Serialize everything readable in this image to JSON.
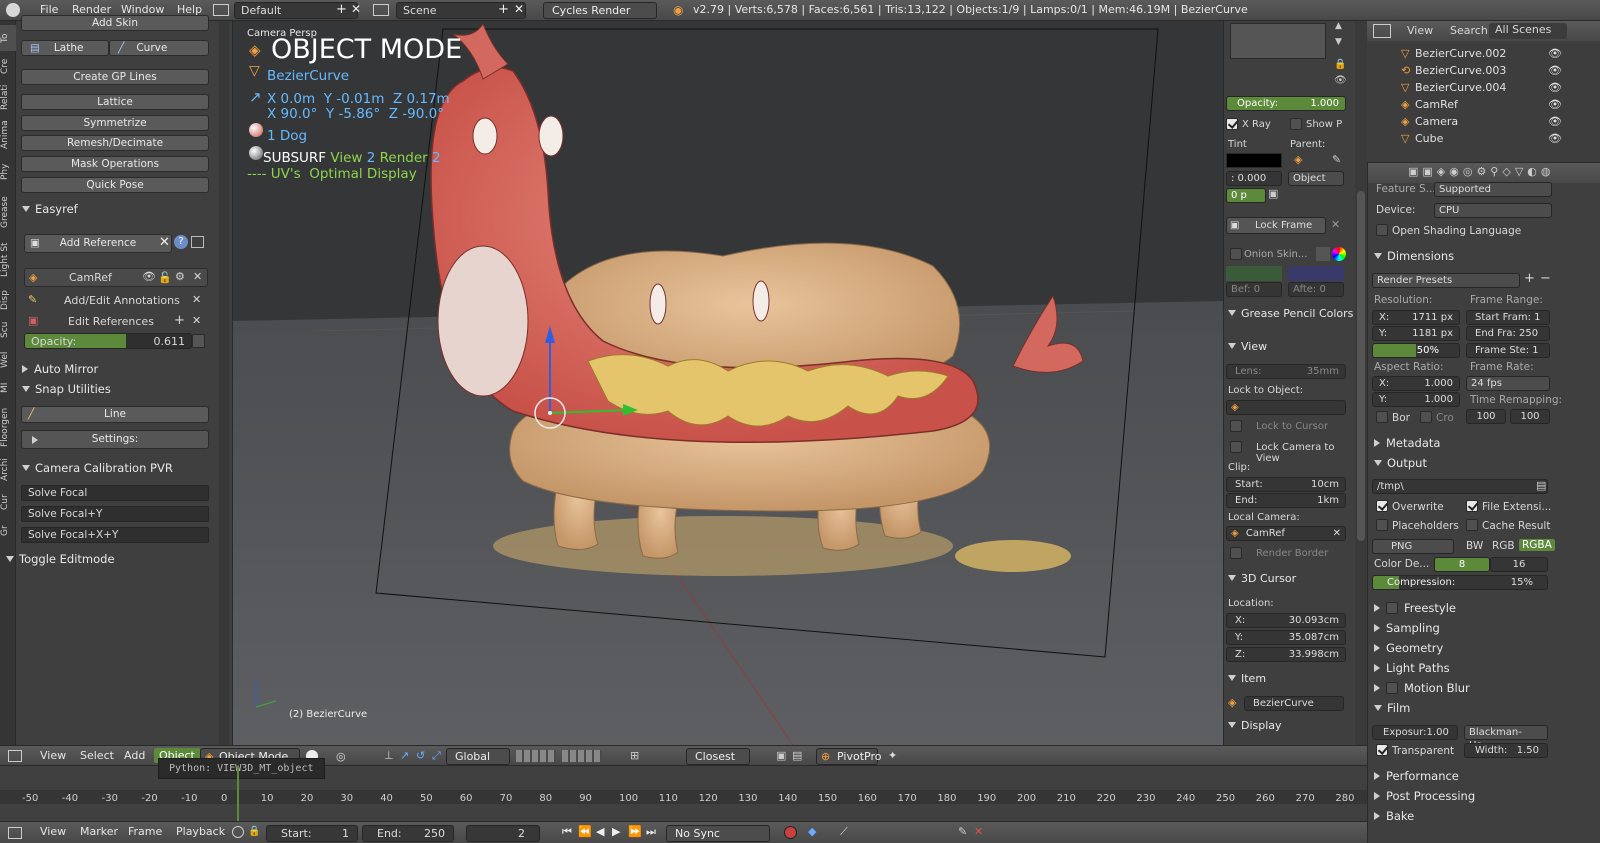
{
  "topbar": {
    "menu": [
      "File",
      "Render",
      "Window",
      "Help"
    ],
    "screen": "Default",
    "scene": "Scene",
    "engine": "Cycles Render",
    "stats": "v2.79 | Verts:6,578 | Faces:6,561 | Tris:13,122 | Objects:1/9 | Lamps:0/1 | Mem:46.19M | BezierCurve"
  },
  "vtabs": [
    "To",
    "Cre",
    "Relati",
    "Anima",
    "Phy",
    "Grease",
    "Light St",
    "Disp",
    "Scu",
    "Wel",
    "MI",
    "Floorgen",
    "Archi",
    "Cur",
    "Gr"
  ],
  "toolshelf": {
    "partial_top": "Add Skin",
    "lathe": "Lathe",
    "curve": "Curve",
    "create_gp_lines": "Create GP Lines",
    "lattice": "Lattice",
    "symmetrize": "Symmetrize",
    "remesh": "Remesh/Decimate",
    "mask_ops": "Mask Operations",
    "quick_pose": "Quick Pose",
    "easyref": "Easyref",
    "add_reference": "Add Reference",
    "camref": "CamRef",
    "add_edit_annotations": "Add/Edit Annotations",
    "edit_references": "Edit References",
    "opacity_label": "Opacity:",
    "opacity_value": "0.611",
    "opacity_fraction": 0.611,
    "auto_mirror": "Auto Mirror",
    "snap_utilities": "Snap Utilities",
    "line": "Line",
    "settings": "Settings:",
    "camera_calibration": "Camera Calibration PVR",
    "solve_focal": "Solve Focal",
    "solve_focal_y": "Solve Focal+Y",
    "solve_focal_xy": "Solve Focal+X+Y",
    "toggle_editmode": "Toggle Editmode"
  },
  "viewport": {
    "camera_persp": "Camera Persp",
    "mode_title": "OBJECT MODE",
    "object_name": "BezierCurve",
    "location": "X 0.0m  Y -0.01m  Z 0.17m",
    "rotation": "X 90.0°  Y -5.86°  Z -90.0°",
    "material": "1 Dog",
    "subsurf_label": "SUBSURF",
    "subsurf_view": "View",
    "subsurf_view_val": "2",
    "subsurf_render": "Render",
    "subsurf_render_val": "2",
    "uvs": "---- UV's  Optimal Display",
    "bottom_label": "(2) BezierCurve"
  },
  "npanel": {
    "opacity_label": "Opacity:",
    "opacity_value": "1.000",
    "xray": "X Ray",
    "show_p": "Show P",
    "tint": "Tint",
    "parent": "Parent:",
    "tint_value": ": 0.000",
    "object": "Object",
    "zero_p": "0 p",
    "lock_frame": "Lock Frame",
    "onion_skin": "Onion Skin...",
    "bef": "Bef: 0",
    "aft": "Afte: 0",
    "grease_pencil_colors": "Grease Pencil Colors",
    "view": "View",
    "lens": "Lens:",
    "lens_value": "35mm",
    "lock_to_object": "Lock to Object:",
    "lock_to_cursor": "Lock to Cursor",
    "lock_camera_to_view": "Lock Camera to View",
    "clip": "Clip:",
    "clip_start_label": "Start:",
    "clip_start": "10cm",
    "clip_end_label": "End:",
    "clip_end": "1km",
    "local_camera": "Local Camera:",
    "camref": "CamRef",
    "render_border": "Render Border",
    "cursor_3d": "3D Cursor",
    "location": "Location:",
    "cursor_x": "30.093cm",
    "cursor_y": "35.087cm",
    "cursor_z": "33.998cm",
    "item": "Item",
    "item_name": "BezierCurve",
    "display": "Display"
  },
  "outliner": {
    "view": "View",
    "search": "Search",
    "all_scenes": "All Scenes",
    "rows": [
      "BezierCurve.002",
      "BezierCurve.003",
      "BezierCurve.004",
      "CamRef",
      "Camera",
      "Cube"
    ]
  },
  "props": {
    "feature_set_label": "Feature S...",
    "feature_set": "Supported",
    "device_label": "Device:",
    "device": "CPU",
    "osl": "Open Shading Language",
    "dimensions": "Dimensions",
    "render_presets": "Render Presets",
    "resolution": "Resolution:",
    "res_x": "1711 px",
    "res_y": "1181 px",
    "res_pct": "50%",
    "res_pct_fraction": 0.5,
    "frame_range": "Frame Range:",
    "start_frame": "Start Fram: 1",
    "end_frame": "End Fra: 250",
    "frame_step": "Frame Ste: 1",
    "aspect_ratio": "Aspect Ratio:",
    "aspect_x": "1.000",
    "aspect_y": "1.000",
    "frame_rate": "Frame Rate:",
    "fps": "24 fps",
    "bor": "Bor",
    "cro": "Cro",
    "time_remapping": "Time Remapping:",
    "remap_old": "100",
    "remap_new": "100",
    "metadata": "Metadata",
    "output": "Output",
    "output_path": "/tmp\\",
    "overwrite": "Overwrite",
    "file_extensions": "File Extensi...",
    "placeholders": "Placeholders",
    "cache_result": "Cache Result",
    "format": "PNG",
    "bw": "BW",
    "rgb": "RGB",
    "rgba": "RGBA",
    "color_depth": "Color De...",
    "depth8": "8",
    "depth16": "16",
    "compression": "Compression:",
    "compression_value": "15%",
    "compression_fraction": 0.15,
    "freestyle": "Freestyle",
    "sampling": "Sampling",
    "geometry": "Geometry",
    "light_paths": "Light Paths",
    "motion_blur": "Motion Blur",
    "film": "Film",
    "exposure": "Exposur:1.00",
    "filter": "Blackman-Ha...",
    "transparent": "Transparent",
    "width": "Width:",
    "width_value": "1.50",
    "performance": "Performance",
    "post_processing": "Post Processing",
    "bake": "Bake"
  },
  "vheader": {
    "view": "View",
    "select": "Select",
    "add": "Add",
    "object": "Object",
    "mode": "Object Mode",
    "orientation": "Global",
    "snap": "Closest",
    "pivot": "PivotPro"
  },
  "timeline": {
    "tooltip": "Python: VIEW3D_MT_object",
    "ticks": [
      "-50",
      "-40",
      "-30",
      "-20",
      "-10",
      "0",
      "10",
      "20",
      "30",
      "40",
      "50",
      "60",
      "70",
      "80",
      "90",
      "100",
      "110",
      "120",
      "130",
      "140",
      "150",
      "160",
      "170",
      "180",
      "190",
      "200",
      "210",
      "220",
      "230",
      "240",
      "250",
      "260",
      "270",
      "280"
    ],
    "view": "View",
    "marker": "Marker",
    "frame": "Frame",
    "playback": "Playback",
    "start_label": "Start:",
    "start": "1",
    "end_label": "End:",
    "end": "250",
    "current": "2",
    "sync": "No Sync"
  }
}
